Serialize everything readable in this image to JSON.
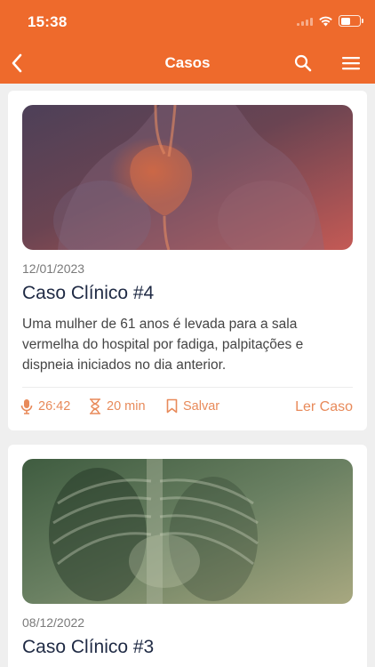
{
  "status": {
    "time": "15:38"
  },
  "nav": {
    "title": "Casos",
    "back_icon": "chevron-left-icon",
    "search_icon": "search-icon",
    "menu_icon": "hamburger-menu-icon"
  },
  "colors": {
    "accent": "#ee6a2c",
    "meta": "#e88a5a",
    "title": "#1f2a44"
  },
  "cases": [
    {
      "date": "12/01/2023",
      "title": "Caso Clínico #4",
      "description": "Uma mulher de 61 anos é levada para a sala vermelha do hospital por fadiga, palpitações e dispneia iniciados no dia anterior.",
      "audio_duration": "26:42",
      "read_time": "20 min",
      "save_label": "Salvar",
      "read_label": "Ler Caso"
    },
    {
      "date": "08/12/2022",
      "title": "Caso Clínico #3"
    }
  ]
}
